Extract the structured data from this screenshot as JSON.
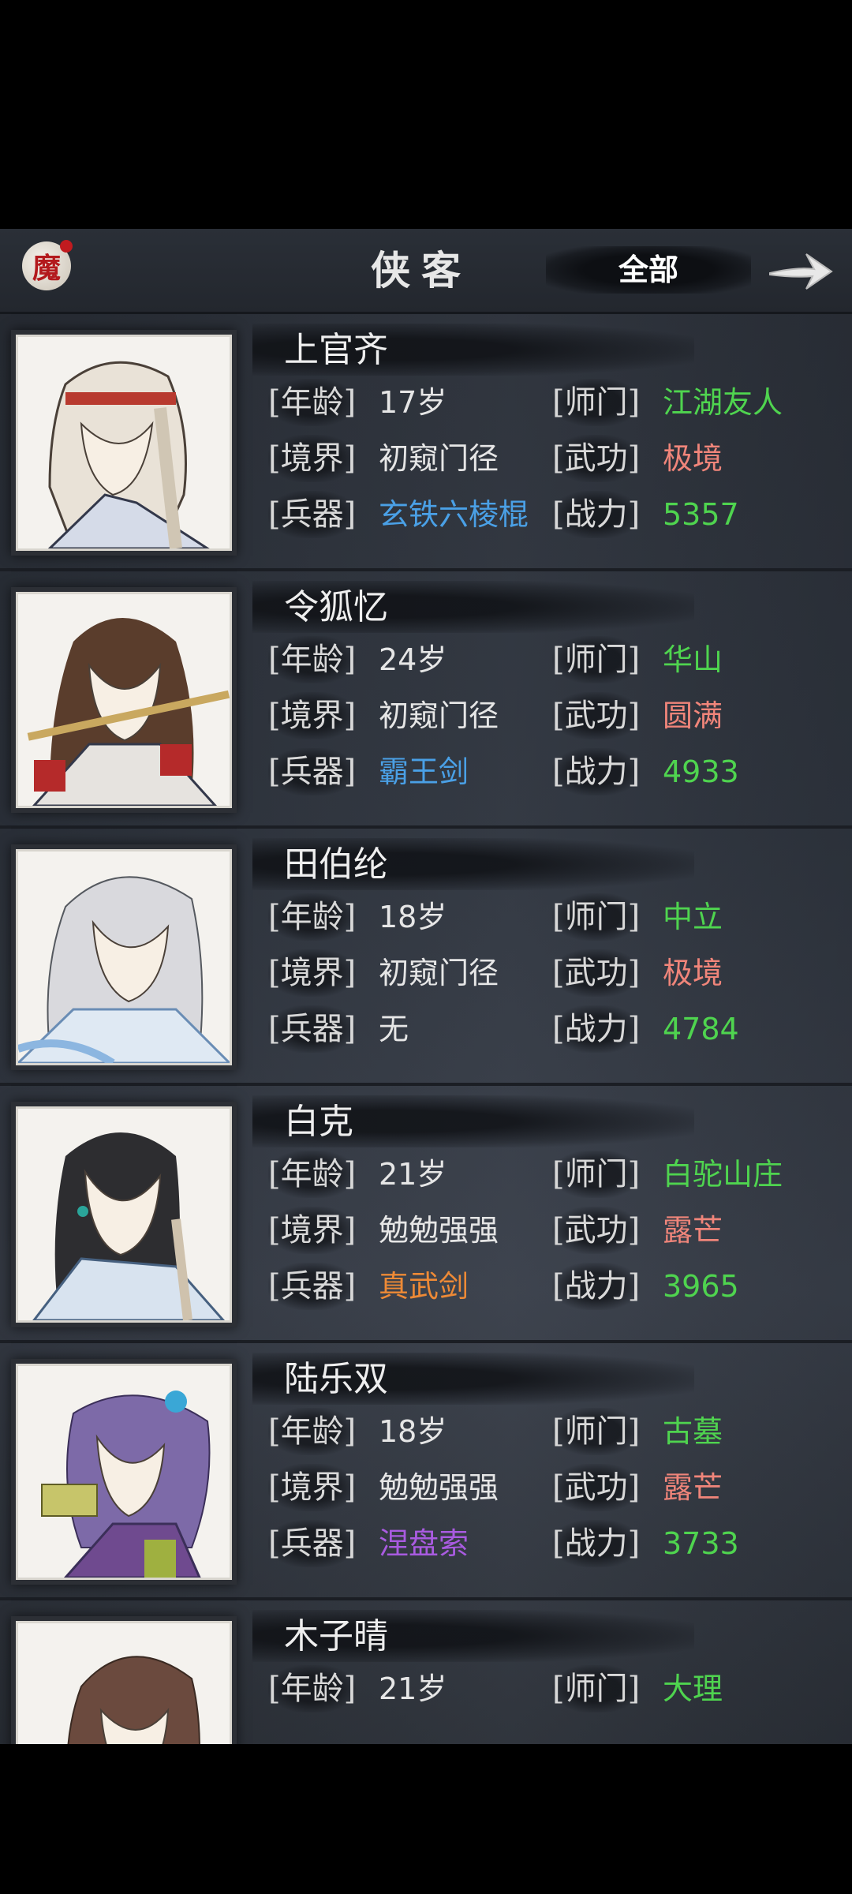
{
  "header": {
    "badge": "魔",
    "title": "侠客",
    "filter": "全部"
  },
  "labels": {
    "age": "[年龄]",
    "realm": "[境界]",
    "weapon": "[兵器]",
    "sect": "[师门]",
    "skill": "[武功]",
    "power": "[战力]"
  },
  "heroes": [
    {
      "name": "上官齐",
      "age": "17岁",
      "realm": "初窥门径",
      "weapon": "玄铁六棱棍",
      "sect": "江湖友人",
      "skill": "极境",
      "power": "5357"
    },
    {
      "name": "令狐忆",
      "age": "24岁",
      "realm": "初窥门径",
      "weapon": "霸王剑",
      "sect": "华山",
      "skill": "圆满",
      "power": "4933"
    },
    {
      "name": "田伯纶",
      "age": "18岁",
      "realm": "初窥门径",
      "weapon": "无",
      "sect": "中立",
      "skill": "极境",
      "power": "4784"
    },
    {
      "name": "白克",
      "age": "21岁",
      "realm": "勉勉强强",
      "weapon": "真武剑",
      "sect": "白驼山庄",
      "skill": "露芒",
      "power": "3965"
    },
    {
      "name": "陆乐双",
      "age": "18岁",
      "realm": "勉勉强强",
      "weapon": "涅盘索",
      "sect": "古墓",
      "skill": "露芒",
      "power": "3733"
    },
    {
      "name": "木子晴",
      "age": "21岁",
      "sect": "大理"
    }
  ],
  "colors": {
    "green": "#4fd44f",
    "pink": "#f0857a",
    "blue": "#4aa0e6",
    "orange": "#ee8a36",
    "purple": "#a95be0"
  }
}
